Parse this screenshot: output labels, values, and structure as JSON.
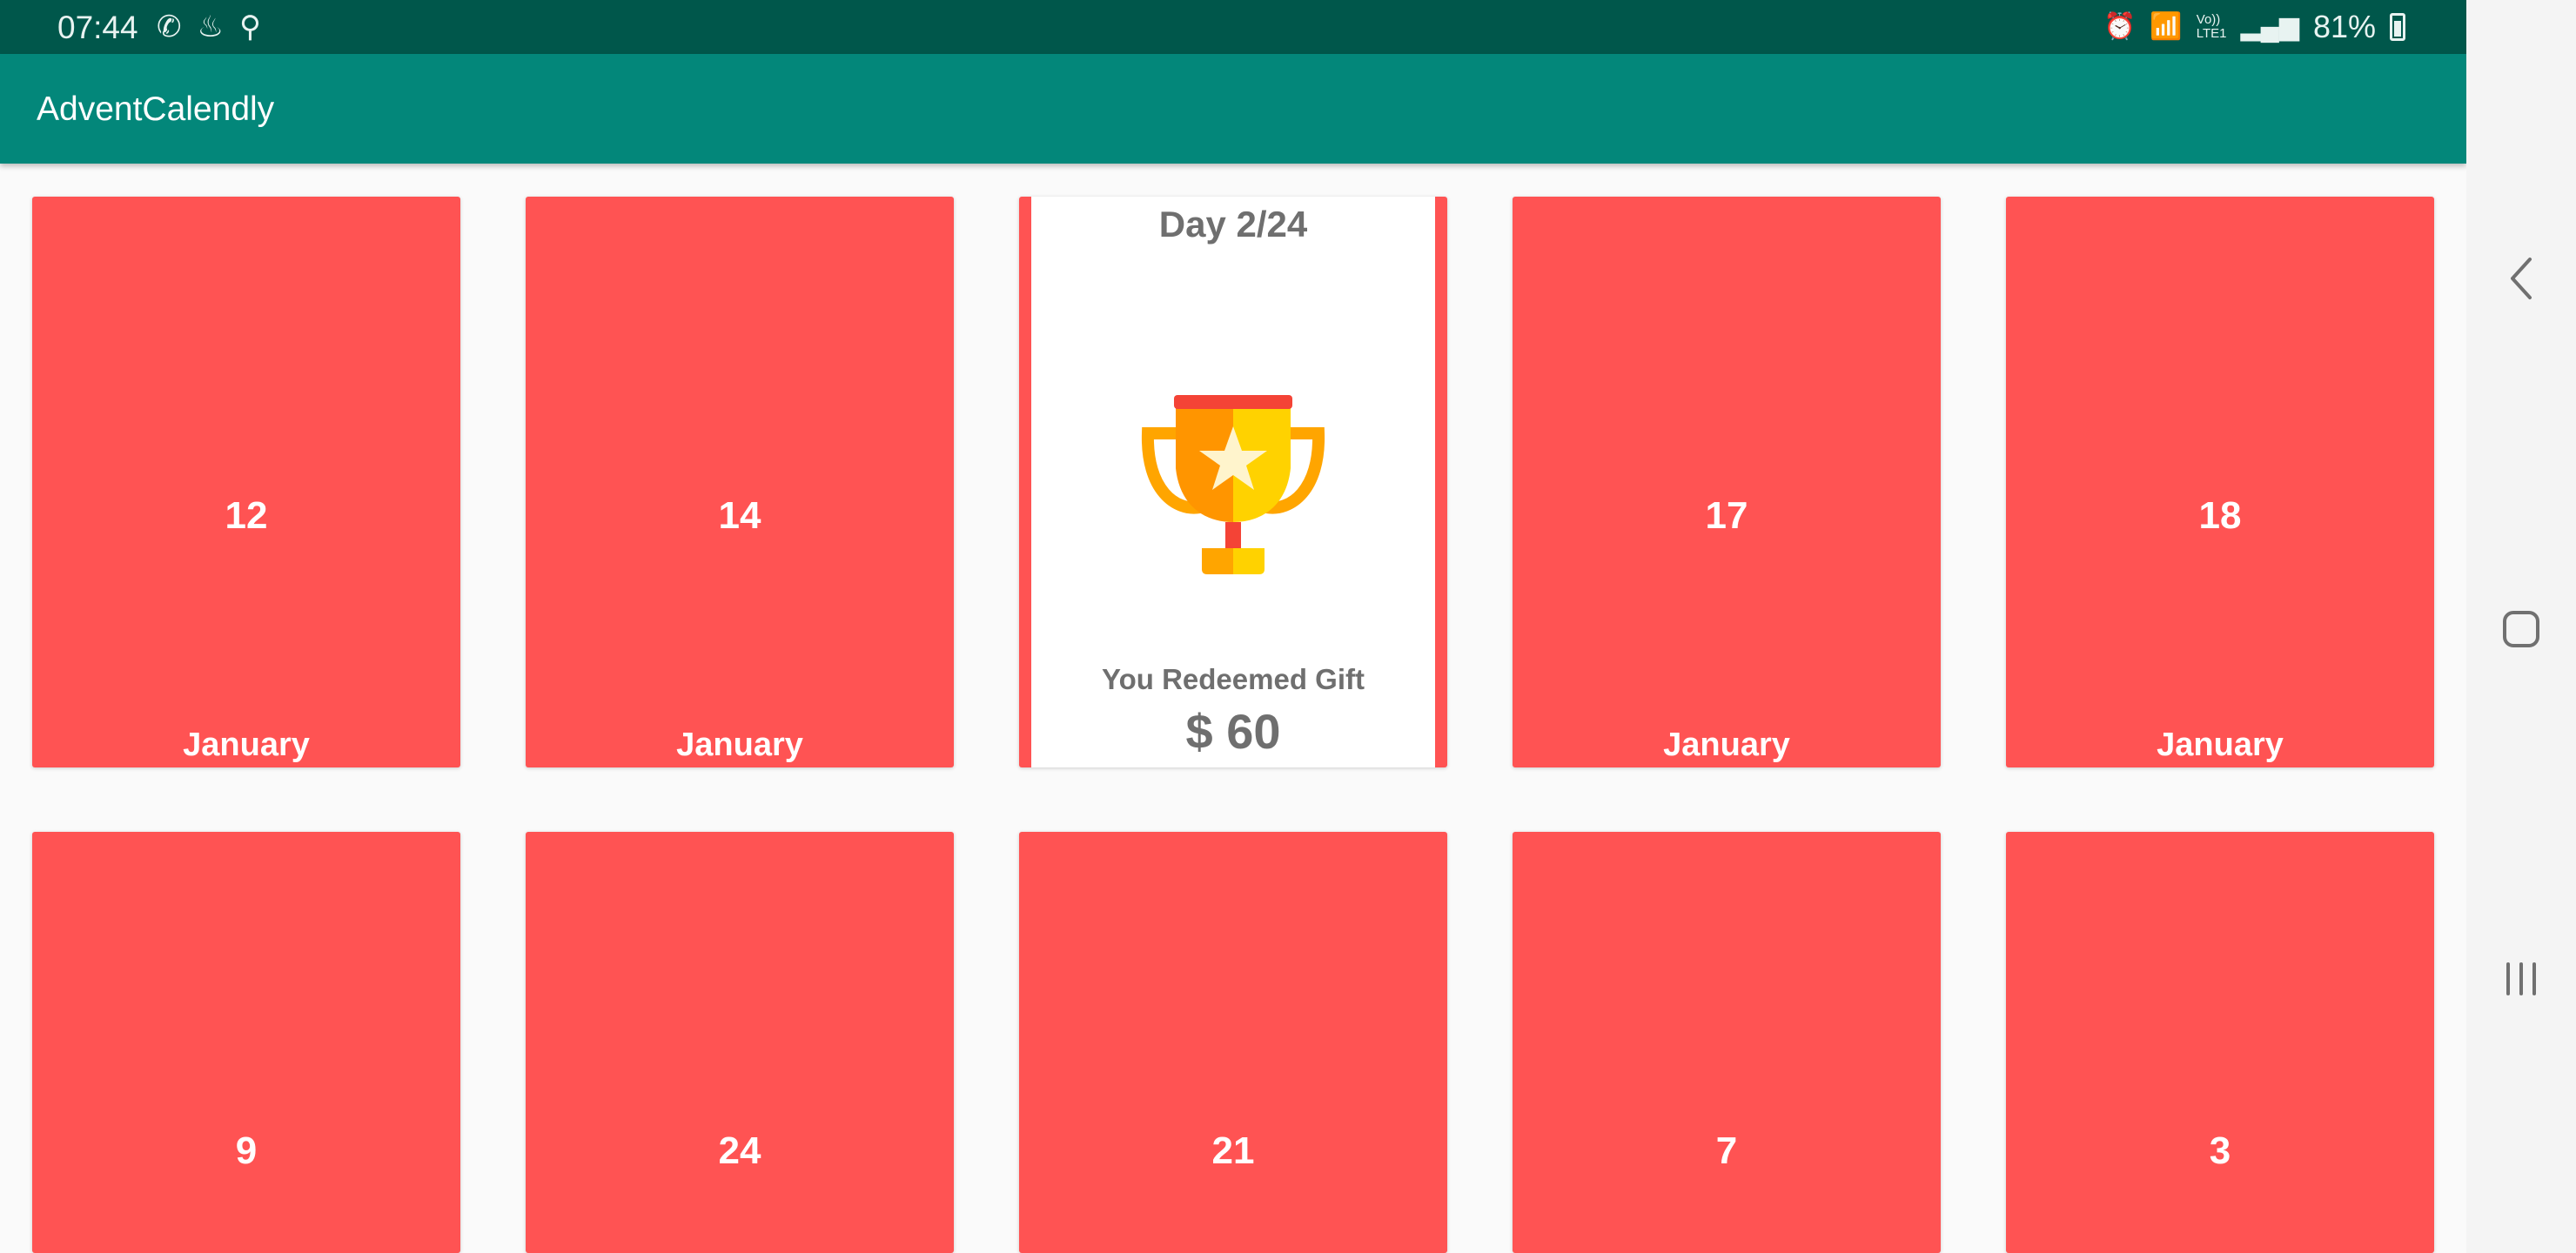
{
  "status_bar": {
    "time": "07:44",
    "left_icons": [
      "whatsapp-icon",
      "notification-icon",
      "fitness-icon"
    ],
    "right_icons": [
      "alarm-icon",
      "wifi-icon",
      "volte-icon",
      "signal-icon"
    ],
    "volte_label": "Vo))",
    "lte_label": "LTE1",
    "battery": "81%"
  },
  "app_bar": {
    "title": "AdventCalendly"
  },
  "colors": {
    "card_red": "#ff5353",
    "app_bar": "#03877a",
    "status_bar": "#00574b",
    "open_text": "#6f6f6f"
  },
  "cards_row1": [
    {
      "number": "12",
      "month": "January"
    },
    {
      "number": "14",
      "month": "January"
    },
    {
      "opened": true,
      "day_label": "Day 2/24",
      "message": "You Redeemed Gift",
      "amount": "$ 60",
      "icon": "trophy-icon"
    },
    {
      "number": "17",
      "month": "January"
    },
    {
      "number": "18",
      "month": "January"
    }
  ],
  "cards_row2": [
    {
      "number": "9"
    },
    {
      "number": "24"
    },
    {
      "number": "21"
    },
    {
      "number": "7"
    },
    {
      "number": "3"
    }
  ],
  "nav_bar": {
    "buttons": [
      "back-icon",
      "home-icon",
      "recents-icon"
    ]
  }
}
